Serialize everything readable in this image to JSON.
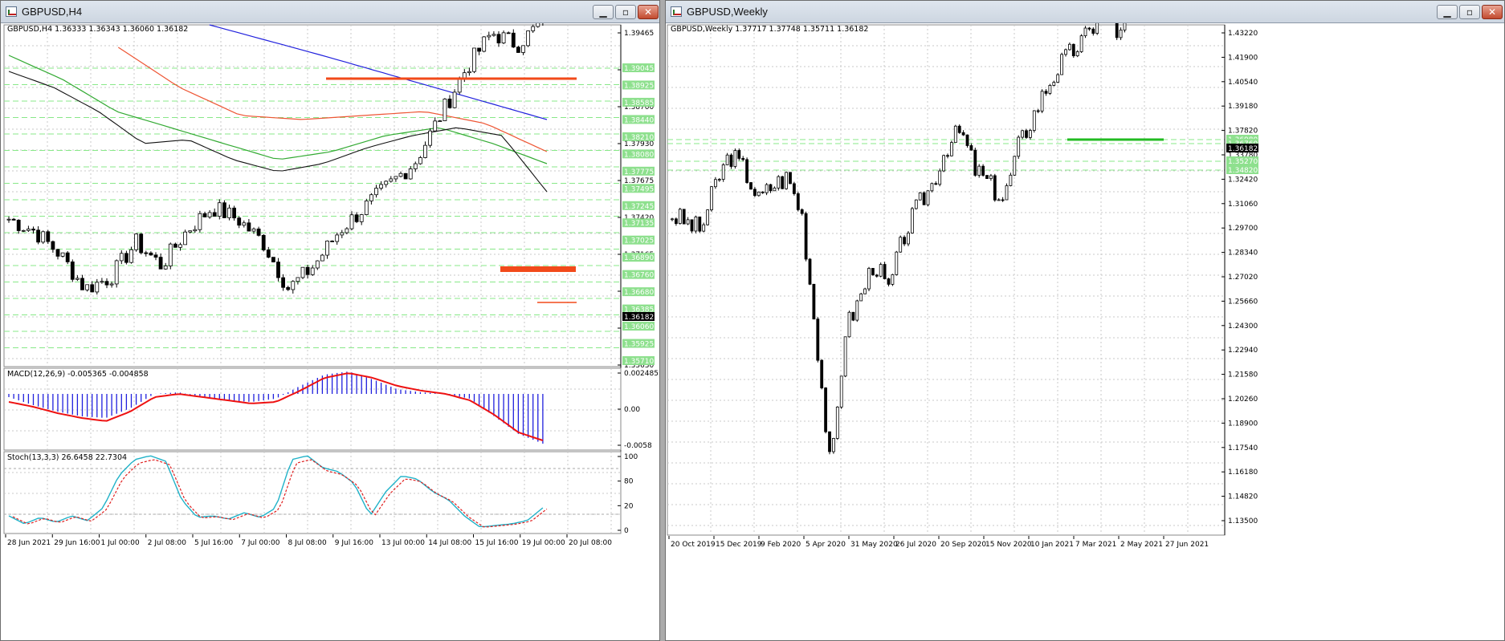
{
  "windows": {
    "left": {
      "title": "GBPUSD,H4",
      "buttons": {
        "minimize": "▁",
        "maximize": "▫",
        "close": "✕"
      },
      "header": "GBPUSD,H4  1.36333 1.36343 1.36060 1.36182",
      "price_ticks": [
        "1.39465",
        "1.39210",
        "1.38700",
        "1.37930",
        "1.37675",
        "1.37420",
        "1.37165",
        "1.36395",
        "1.35885",
        "1.35630"
      ],
      "level_tags": [
        "1.39045",
        "1.38925",
        "1.38585",
        "1.38440",
        "1.38210",
        "1.38080",
        "1.37775",
        "1.37495",
        "1.37245",
        "1.37135",
        "1.37025",
        "1.36890",
        "1.36760",
        "1.36680",
        "1.36385",
        "1.36060",
        "1.35925",
        "1.35710"
      ],
      "current_price": "1.36182",
      "time_labels": [
        "28 Jun 2021",
        "29 Jun 16:00",
        "1 Jul 00:00",
        "2 Jul 08:00",
        "5 Jul 16:00",
        "7 Jul 00:00",
        "8 Jul 08:00",
        "9 Jul 16:00",
        "13 Jul 00:00",
        "14 Jul 08:00",
        "15 Jul 16:00",
        "19 Jul 00:00",
        "20 Jul 08:00"
      ],
      "macd": {
        "header": "MACD(12,26,9) -0.005365 -0.004858",
        "ticks": [
          "0.002485",
          "0.00",
          "-0.0058"
        ]
      },
      "stoch": {
        "header": "Stoch(13,3,3) 26.6458 22.7304",
        "ticks": [
          "100",
          "80",
          "20",
          "0"
        ]
      }
    },
    "right": {
      "title": "GBPUSD,Weekly",
      "buttons": {
        "minimize": "▁",
        "maximize": "▫",
        "close": "✕"
      },
      "header": "GBPUSD,Weekly  1.37717 1.37748 1.35711 1.36182",
      "price_ticks": [
        "1.43220",
        "1.41900",
        "1.40540",
        "1.39180",
        "1.37820",
        "1.33780",
        "1.32420",
        "1.31060",
        "1.29700",
        "1.28340",
        "1.27020",
        "1.25660",
        "1.24300",
        "1.22940",
        "1.21580",
        "1.20260",
        "1.18900",
        "1.17540",
        "1.16180",
        "1.14820",
        "1.13500"
      ],
      "level_tags": [
        "1.36980",
        "1.36760",
        "1.35270",
        "1.34820"
      ],
      "current_price": "1.36182",
      "time_labels": [
        "20 Oct 2019",
        "15 Dec 2019",
        "9 Feb 2020",
        "5 Apr 2020",
        "31 May 2020",
        "26 Jul 2020",
        "20 Sep 2020",
        "15 Nov 2020",
        "10 Jan 2021",
        "7 Mar 2021",
        "2 May 2021",
        "27 Jun 2021"
      ]
    }
  },
  "colors": {
    "bg_window": "#ababab",
    "grid": "#c8c8c8",
    "level": "#88e888",
    "level_tag": "#8ee08e",
    "resistance": "#f24a1a",
    "support": "#22bb22",
    "macd_signal": "#ee1111",
    "macd_hist": "#1f1fdd",
    "stoch_main": "#20b2c8",
    "stoch_signal": "#e02020",
    "ma_blue": "#2020dd",
    "ma_red": "#ee5533",
    "ma_green": "#33aa33"
  }
}
